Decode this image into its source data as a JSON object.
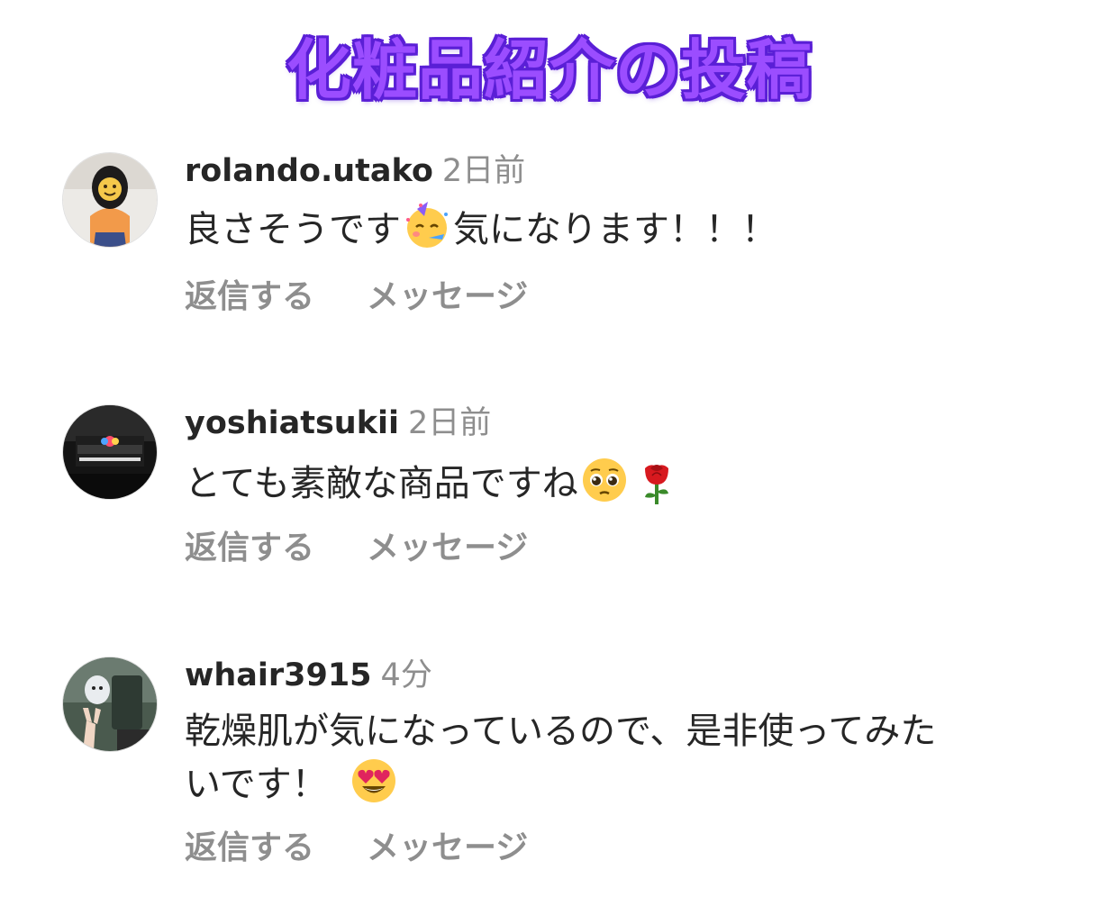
{
  "title": "化粧品紹介の投稿",
  "actions": {
    "reply_label": "返信する",
    "message_label": "メッセージ"
  },
  "comments": [
    {
      "username": "rolando.utako",
      "time": "2日前",
      "text_before": "良さそうです",
      "text_after": "気になります！！！",
      "emojis": [
        "partying-face-icon"
      ]
    },
    {
      "username": "yoshiatsukii",
      "time": "2日前",
      "text_before": "とても素敵な商品ですね",
      "emojis": [
        "pleading-face-icon",
        "rose-icon"
      ]
    },
    {
      "username": "whair3915",
      "time": "4分",
      "text_line1": "乾燥肌が気になっているので、是非使ってみた",
      "text_line2": "いです！",
      "emojis": [
        "heart-eyes-face-icon"
      ]
    }
  ],
  "colors": {
    "title_fill": "#9b4dff",
    "title_outline": "#5a1fd6",
    "username": "#262626",
    "meta_gray": "#8e8e8e"
  }
}
